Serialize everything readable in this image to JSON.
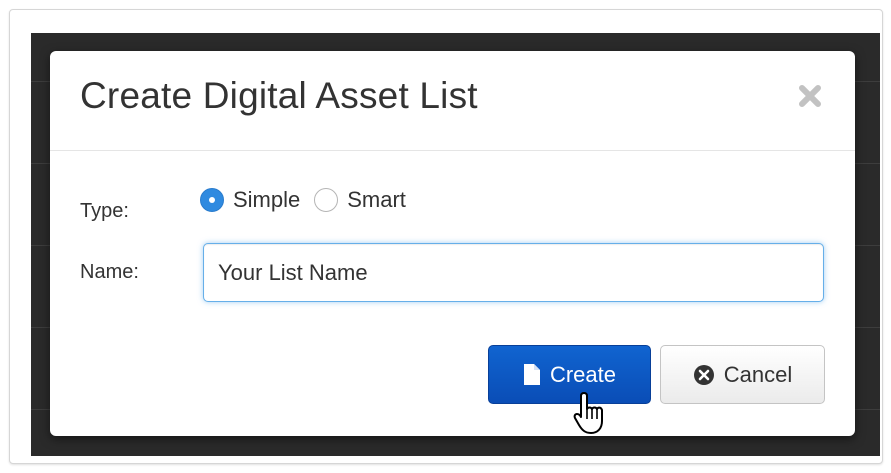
{
  "modal": {
    "title": "Create Digital Asset List",
    "close_icon": "close-icon",
    "type_label": "Type:",
    "type_options": [
      {
        "label": "Simple",
        "checked": true
      },
      {
        "label": "Smart",
        "checked": false
      }
    ],
    "name_label": "Name:",
    "name_value": "Your List Name",
    "create_label": "Create",
    "create_icon": "file-icon",
    "cancel_label": "Cancel",
    "cancel_icon": "times-circle-icon"
  },
  "colors": {
    "primary": "#0a4db6",
    "radio_checked": "#2f8ae0",
    "backdrop": "#2a2a2a",
    "input_focus": "#66afe9"
  },
  "cursor": "hand-pointer-icon"
}
